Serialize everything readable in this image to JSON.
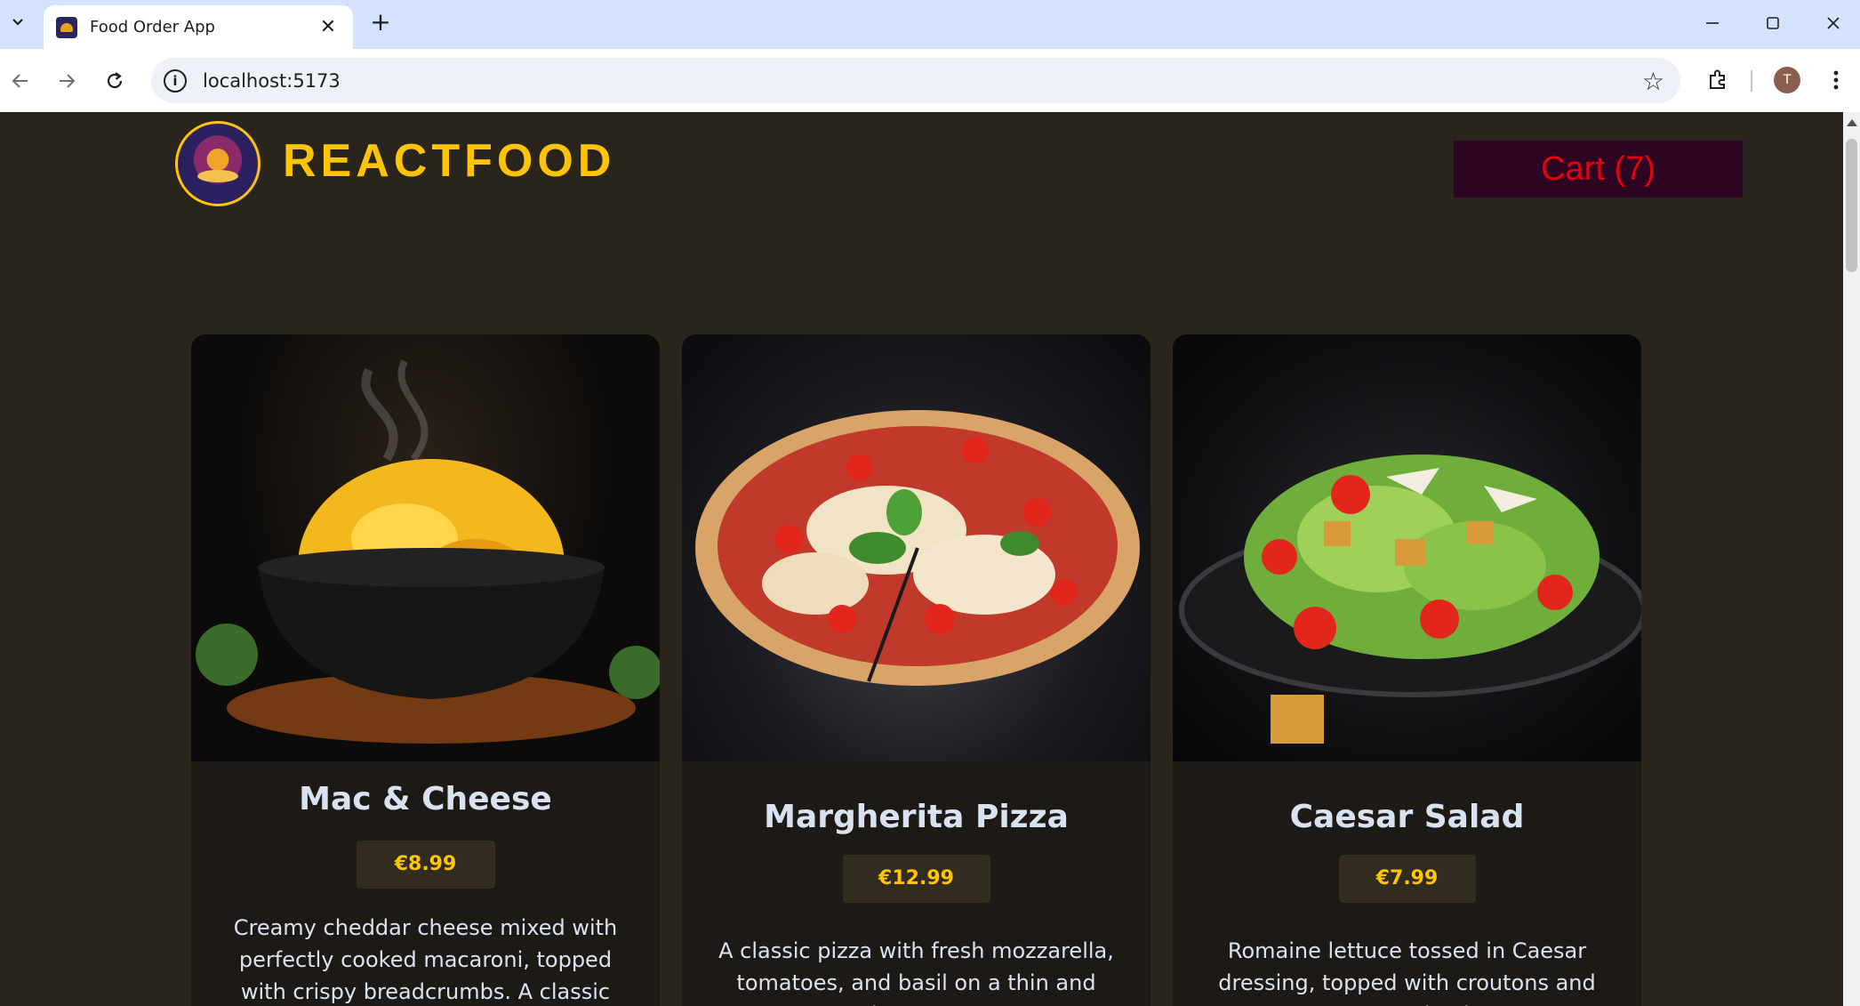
{
  "browser": {
    "tab_title": "Food Order App",
    "url": "localhost:5173",
    "profile_initial": "T"
  },
  "app": {
    "logo_title": "REACTFOOD",
    "cart_label": "Cart (7)",
    "colors": {
      "background": "#29251c",
      "accent": "#ffc404",
      "cart_text": "#e5000e",
      "cart_bg": "#2d0422",
      "card_bg": "#1d1a16",
      "price_bg": "#312c1d"
    }
  },
  "meals": [
    {
      "name": "Mac & Cheese",
      "price": "€8.99",
      "description": "Creamy cheddar cheese mixed with perfectly cooked macaroni, topped with crispy breadcrumbs. A classic comfort"
    },
    {
      "name": "Margherita Pizza",
      "price": "€12.99",
      "description": "A classic pizza with fresh mozzarella, tomatoes, and basil on a thin and crispy crust."
    },
    {
      "name": "Caesar Salad",
      "price": "€7.99",
      "description": "Romaine lettuce tossed in Caesar dressing, topped with croutons and parmesan shavings."
    }
  ]
}
